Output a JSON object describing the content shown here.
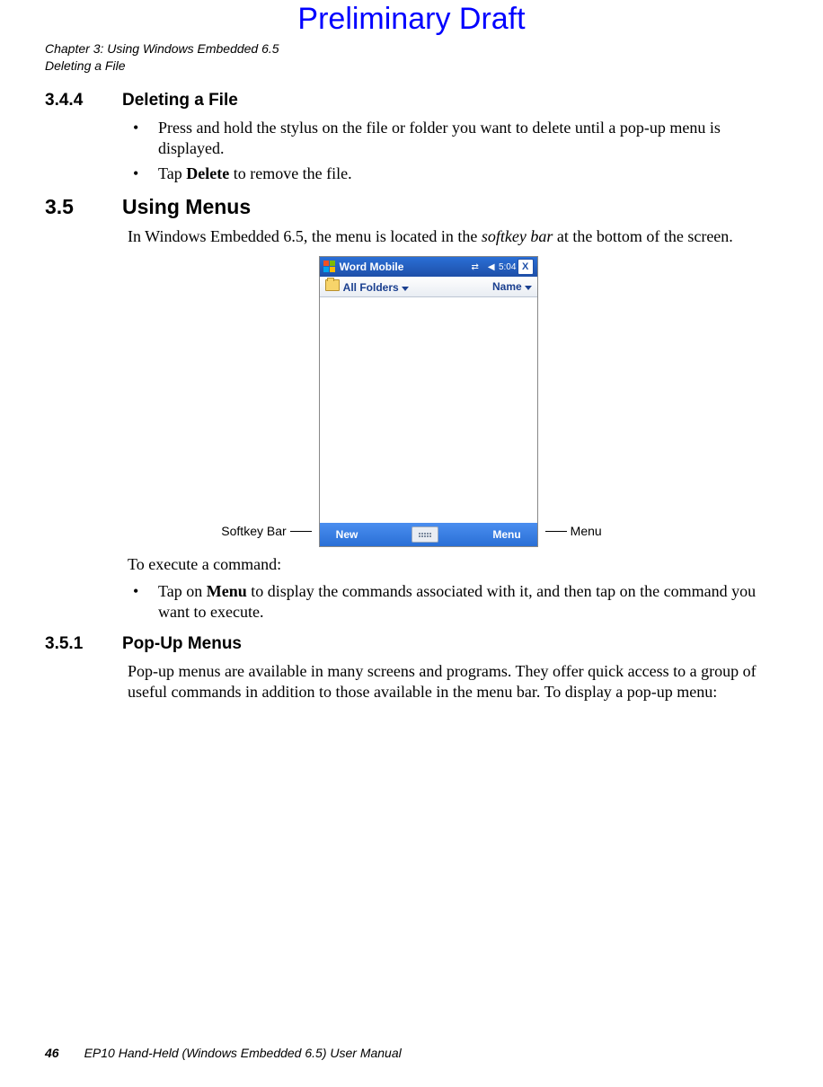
{
  "watermark": "Preliminary Draft",
  "header": {
    "chapter_line": "Chapter 3:  Using Windows Embedded 6.5",
    "section_line": "Deleting a File"
  },
  "s344": {
    "number": "3.4.4",
    "title": "Deleting a File",
    "bullet1_a": "Press and hold the stylus on the file or folder you want to delete until a pop-up menu is displayed.",
    "bullet2_a": "Tap ",
    "bullet2_b": "Delete",
    "bullet2_c": " to remove the file."
  },
  "s35": {
    "number": "3.5",
    "title": "Using Menus",
    "intro_a": "In Windows Embedded 6.5, the menu is located in the ",
    "intro_b": "softkey bar",
    "intro_c": " at the bottom of the screen.",
    "callout_left": "Softkey Bar",
    "callout_right": "Menu",
    "exec_label": "To execute a command:",
    "bullet1_a": "Tap on ",
    "bullet1_b": "Menu",
    "bullet1_c": " to display the commands associated with it, and then tap on the command you want to execute."
  },
  "screenshot": {
    "app_name": "Word Mobile",
    "time": "5:04",
    "close": "X",
    "all_folders": "All Folders",
    "name_label": "Name",
    "softkey_left": "New",
    "softkey_right": "Menu"
  },
  "s351": {
    "number": "3.5.1",
    "title": "Pop-Up Menus",
    "para": "Pop-up menus are available in many screens and programs. They offer quick access to a group of useful commands in addition to those available in the menu bar. To display a pop-up menu:"
  },
  "footer": {
    "page_number": "46",
    "manual_title": "EP10 Hand-Held (Windows Embedded 6.5) User Manual"
  }
}
